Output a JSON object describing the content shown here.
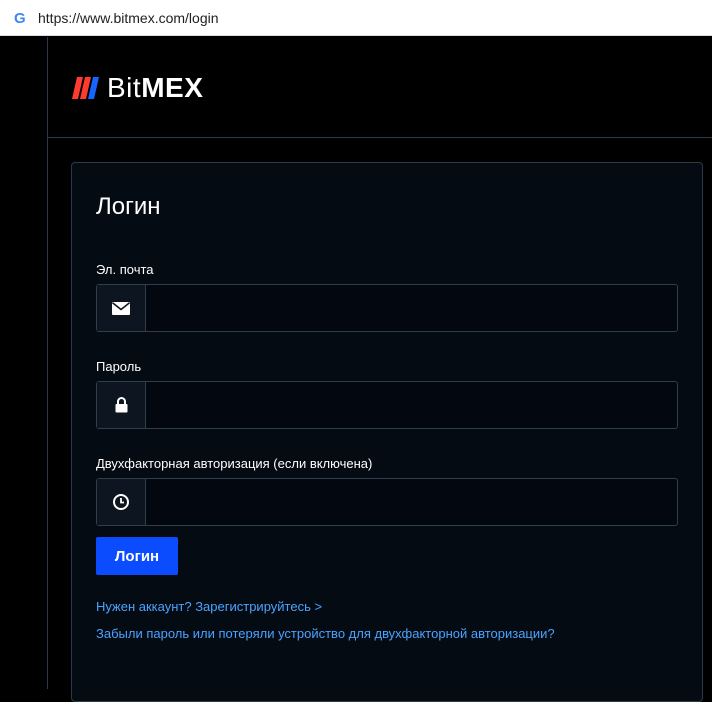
{
  "browser": {
    "favicon": "G",
    "url": "https://www.bitmex.com/login"
  },
  "header": {
    "logo_bit": "Bit",
    "logo_mex": "MEX",
    "brand_color": "#ff3b30",
    "accent_color": "#0b4cff"
  },
  "login": {
    "title": "Логин",
    "email_label": "Эл. почта",
    "email_value": "",
    "email_icon": "envelope-icon",
    "password_label": "Пароль",
    "password_value": "",
    "password_icon": "lock-icon",
    "twofa_label": "Двухфакторная авторизация (если включена)",
    "twofa_value": "",
    "twofa_icon": "clock-icon",
    "submit_label": "Логин",
    "register_link": "Нужен аккаунт? Зарегистрируйтесь >",
    "forgot_link": "Забыли пароль или потеряли устройство для двухфакторной авторизации?"
  }
}
